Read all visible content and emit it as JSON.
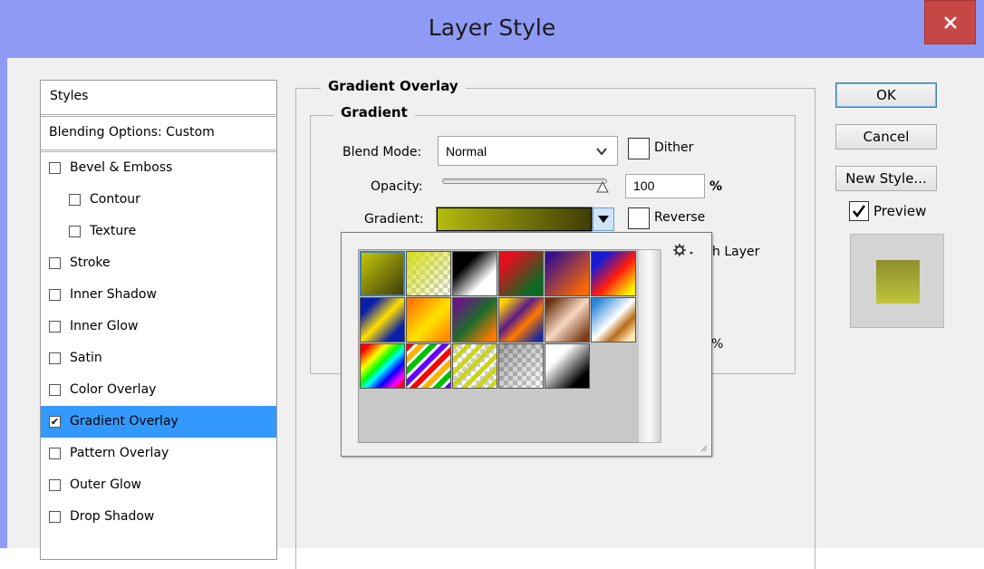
{
  "window": {
    "title": "Layer Style",
    "close_icon": "close-icon"
  },
  "styles_panel": {
    "header": "Styles",
    "blending_options": "Blending Options: Custom",
    "items": [
      {
        "label": "Bevel & Emboss",
        "checked": false,
        "indent": false
      },
      {
        "label": "Contour",
        "checked": false,
        "indent": true
      },
      {
        "label": "Texture",
        "checked": false,
        "indent": true
      },
      {
        "label": "Stroke",
        "checked": false,
        "indent": false
      },
      {
        "label": "Inner Shadow",
        "checked": false,
        "indent": false
      },
      {
        "label": "Inner Glow",
        "checked": false,
        "indent": false
      },
      {
        "label": "Satin",
        "checked": false,
        "indent": false
      },
      {
        "label": "Color Overlay",
        "checked": false,
        "indent": false
      },
      {
        "label": "Gradient Overlay",
        "checked": true,
        "indent": false,
        "selected": true
      },
      {
        "label": "Pattern Overlay",
        "checked": false,
        "indent": false
      },
      {
        "label": "Outer Glow",
        "checked": false,
        "indent": false
      },
      {
        "label": "Drop Shadow",
        "checked": false,
        "indent": false
      }
    ]
  },
  "gradient_overlay": {
    "section_title": "Gradient Overlay",
    "group_title": "Gradient",
    "blend_mode_label": "Blend Mode:",
    "blend_mode_value": "Normal",
    "dither_label": "Dither",
    "dither_checked": false,
    "opacity_label": "Opacity:",
    "opacity_value": "100",
    "opacity_unit": "%",
    "opacity_fraction": 1.0,
    "gradient_label": "Gradient:",
    "reverse_label": "Reverse",
    "reverse_checked": false,
    "partial_align_label": "h Layer",
    "partial_percent": "%",
    "current_gradient": [
      "#b4bb0f",
      "#403d05"
    ]
  },
  "gradient_picker": {
    "gear_icon": "gear-icon",
    "presets": [
      {
        "name": "yellow-olive",
        "css": "linear-gradient(135deg,#c3c80c,#3f3c06)"
      },
      {
        "name": "yellow-transparent",
        "css": "linear-gradient(135deg,#d4de1a 0%,rgba(212,222,26,0) 100%)",
        "checker": true
      },
      {
        "name": "black-white",
        "css": "linear-gradient(135deg,#000 30%,#fff 70%)"
      },
      {
        "name": "red-green",
        "css": "linear-gradient(135deg,#e0101e 20%,#0b6a24 80%)"
      },
      {
        "name": "violet-orange",
        "css": "linear-gradient(135deg,#35108e 10%,#ff6b00 90%)"
      },
      {
        "name": "blue-red-yellow",
        "css": "linear-gradient(135deg,#1b1ad3 20%,#ff1a10 55%,#fff200 90%)"
      },
      {
        "name": "blue-yellow-blue",
        "css": "linear-gradient(135deg,#0b1fa8 20%,#ffe000 50%,#0b1fa8 80%)"
      },
      {
        "name": "orange-yellow-orange",
        "css": "linear-gradient(135deg,#ff7a00 10%,#ffe300 55%,#ff8a00 90%)"
      },
      {
        "name": "violet-green-orange",
        "css": "linear-gradient(135deg,#6a1488 10%,#1f6b2b 50%,#ff7a00 90%)"
      },
      {
        "name": "yellow-violet-orange-blue",
        "css": "linear-gradient(135deg,#ffcf00 10%,#5a1c8a 40%,#ff7a00 60%,#1c2a9c 90%)"
      },
      {
        "name": "copper",
        "css": "linear-gradient(135deg,#6b3312 10%,#f6d6c0 50%,#7a3d18 90%)"
      },
      {
        "name": "chrome",
        "css": "linear-gradient(135deg,#2a86d8 10%,#ffffff 50%,#b86a16 70%,#ffe9b0 90%)"
      },
      {
        "name": "spectrum",
        "css": "linear-gradient(135deg,#ff0000 10%,#ffff00 30%,#00ff00 45%,#00ffff 55%,#0000ff 70%,#ff00ff 85%,#ff0000 95%)"
      },
      {
        "name": "transparent-rainbow",
        "css": "repeating-linear-gradient(135deg,#ff0000 0 6px,#ffffff 6px 9px,#ffb000 9px 15px,#ffffff 15px 18px,#00c000 18px 24px,#ffffff 24px 27px,#6a00ff 27px 33px,#ffffff 33px 36px)"
      },
      {
        "name": "transparent-stripes",
        "css": "repeating-linear-gradient(135deg,#cbd41a 0 5px,rgba(255,255,255,0) 5px 10px)",
        "checker": true
      },
      {
        "name": "neutral-density",
        "css": "linear-gradient(135deg,rgba(0,0,0,.35),rgba(0,0,0,0))",
        "checker": true
      },
      {
        "name": "black-transparent",
        "css": "linear-gradient(135deg,#ffffff 30%,#000000 80%)"
      }
    ]
  },
  "buttons": {
    "ok": "OK",
    "cancel": "Cancel",
    "new_style": "New Style...",
    "preview_label": "Preview",
    "preview_checked": true
  },
  "preview_colors": {
    "top": "#8e8e2c",
    "bottom": "#bfc43c"
  },
  "colors": {
    "titlebar": "#8f9af5",
    "close": "#c74646",
    "selection": "#3399ff"
  }
}
